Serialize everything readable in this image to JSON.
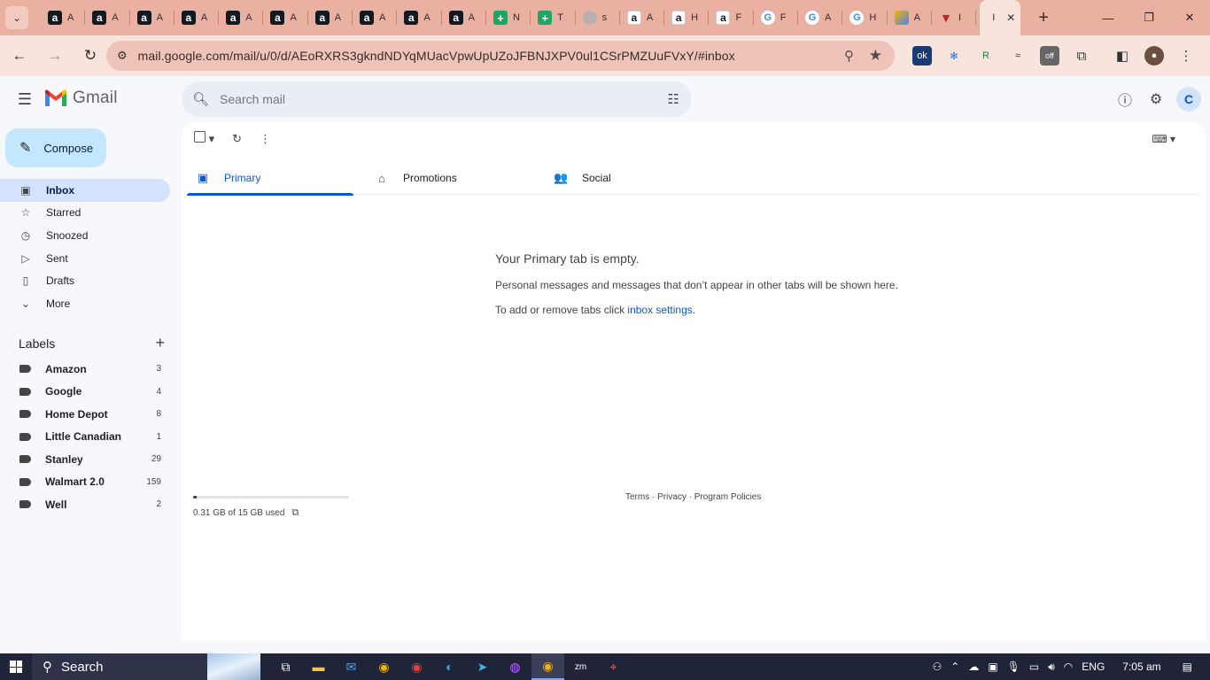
{
  "browser": {
    "tabs": [
      {
        "icon": "a",
        "kind": "amazon",
        "title": "A"
      },
      {
        "icon": "a",
        "kind": "amazon",
        "title": "A"
      },
      {
        "icon": "a",
        "kind": "amazon",
        "title": "A"
      },
      {
        "icon": "a",
        "kind": "amazon",
        "title": "A"
      },
      {
        "icon": "a",
        "kind": "amazon",
        "title": "A"
      },
      {
        "icon": "a",
        "kind": "amazon",
        "title": "A"
      },
      {
        "icon": "a",
        "kind": "amazon",
        "title": "A"
      },
      {
        "icon": "a",
        "kind": "amazon",
        "title": "A"
      },
      {
        "icon": "a",
        "kind": "amazon",
        "title": "A"
      },
      {
        "icon": "a",
        "kind": "amazon",
        "title": "A"
      },
      {
        "icon": "+",
        "kind": "sheets",
        "title": "N"
      },
      {
        "icon": "+",
        "kind": "sheets",
        "title": "T"
      },
      {
        "icon": "",
        "kind": "grey",
        "title": "s"
      },
      {
        "icon": "a",
        "kind": "amazon2",
        "title": "A"
      },
      {
        "icon": "a",
        "kind": "amazon2",
        "title": "H"
      },
      {
        "icon": "a",
        "kind": "amazon2",
        "title": "F"
      },
      {
        "icon": "G",
        "kind": "google",
        "title": "F"
      },
      {
        "icon": "G",
        "kind": "google",
        "title": "A"
      },
      {
        "icon": "G",
        "kind": "google",
        "title": "H"
      },
      {
        "icon": "",
        "kind": "multi",
        "title": "A"
      },
      {
        "icon": "▼",
        "kind": "red",
        "title": "I"
      }
    ],
    "active_tab_title": "I",
    "url": "mail.google.com/mail/u/0/d/AEoRXRS3gkndNDYqMUacVpwUpUZoJFBNJXPV0ul1CSrPMZUuFVxY/#inbox"
  },
  "gmail": {
    "brand": "Gmail",
    "search_placeholder": "Search mail",
    "avatar_letter": "C",
    "compose": "Compose",
    "nav": [
      {
        "icon": "▣",
        "label": "Inbox",
        "active": true
      },
      {
        "icon": "☆",
        "label": "Starred",
        "active": false
      },
      {
        "icon": "◷",
        "label": "Snoozed",
        "active": false
      },
      {
        "icon": "▷",
        "label": "Sent",
        "active": false
      },
      {
        "icon": "▯",
        "label": "Drafts",
        "active": false
      },
      {
        "icon": "⌄",
        "label": "More",
        "active": false
      }
    ],
    "labels_title": "Labels",
    "labels": [
      {
        "name": "Amazon",
        "count": "3"
      },
      {
        "name": "Google",
        "count": "4"
      },
      {
        "name": "Home Depot",
        "count": "8"
      },
      {
        "name": "Little Canadian",
        "count": "1"
      },
      {
        "name": "Stanley",
        "count": "29"
      },
      {
        "name": "Walmart 2.0",
        "count": "159"
      },
      {
        "name": "Well",
        "count": "2"
      }
    ],
    "category_tabs": [
      {
        "icon": "▣",
        "label": "Primary",
        "active": true
      },
      {
        "icon": "⌂",
        "label": "Promotions",
        "active": false
      },
      {
        "icon": "👥",
        "label": "Social",
        "active": false
      }
    ],
    "empty_title": "Your Primary tab is empty.",
    "empty_desc": "Personal messages and messages that don’t appear in other tabs will be shown here.",
    "empty_action_prefix": "To add or remove tabs click ",
    "empty_action_link": "inbox settings",
    "empty_action_suffix": ".",
    "storage_text": "0.31 GB of 15 GB used",
    "storage_fraction": 0.021,
    "footer": "Terms · Privacy · Program Policies"
  },
  "taskbar": {
    "search": "Search",
    "lang": "ENG",
    "time": "7:05 am"
  },
  "colors": {
    "accent": "#0b57d0",
    "compose_bg": "#c2e7ff",
    "active_nav_bg": "#d3e3fd",
    "tabstrip_bg": "#eab0a2"
  }
}
